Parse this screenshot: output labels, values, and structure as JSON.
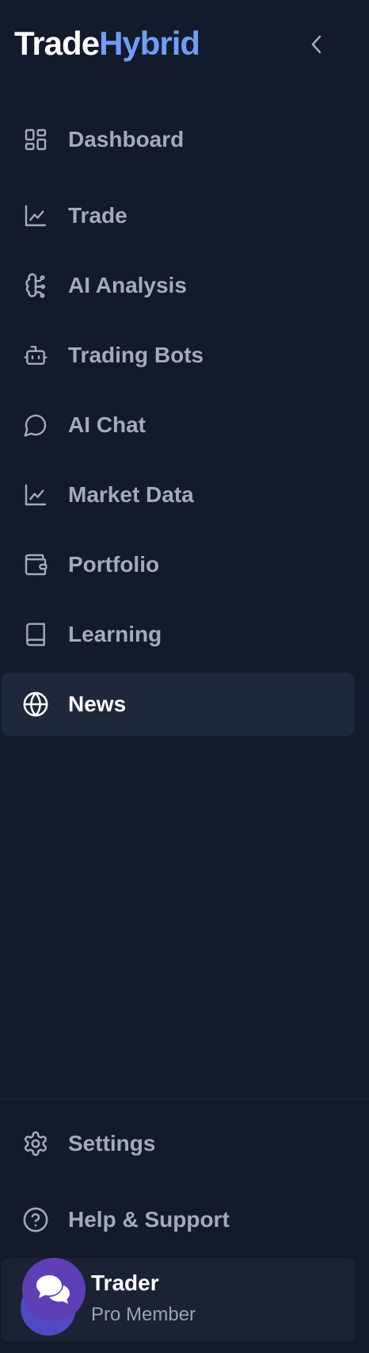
{
  "brand": {
    "part1": "Trade",
    "part2": "Hybrid"
  },
  "nav": {
    "items": [
      {
        "label": "Dashboard",
        "icon": "dashboard-grid-icon"
      },
      {
        "label": "Trade",
        "icon": "line-chart-icon"
      },
      {
        "label": "AI Analysis",
        "icon": "brain-circuit-icon"
      },
      {
        "label": "Trading Bots",
        "icon": "bot-icon"
      },
      {
        "label": "AI Chat",
        "icon": "message-circle-icon"
      },
      {
        "label": "Market Data",
        "icon": "line-chart-icon"
      },
      {
        "label": "Portfolio",
        "icon": "wallet-icon"
      },
      {
        "label": "Learning",
        "icon": "book-icon"
      },
      {
        "label": "News",
        "icon": "globe-icon",
        "active": true
      }
    ]
  },
  "footer": {
    "settings_label": "Settings",
    "help_label": "Help & Support"
  },
  "profile": {
    "name": "Trader",
    "role": "Pro Member"
  },
  "colors": {
    "background": "#131a2c",
    "accent": "#6f9ff4",
    "active_bg": "#1e283a",
    "avatar": "#5e3fb6"
  }
}
